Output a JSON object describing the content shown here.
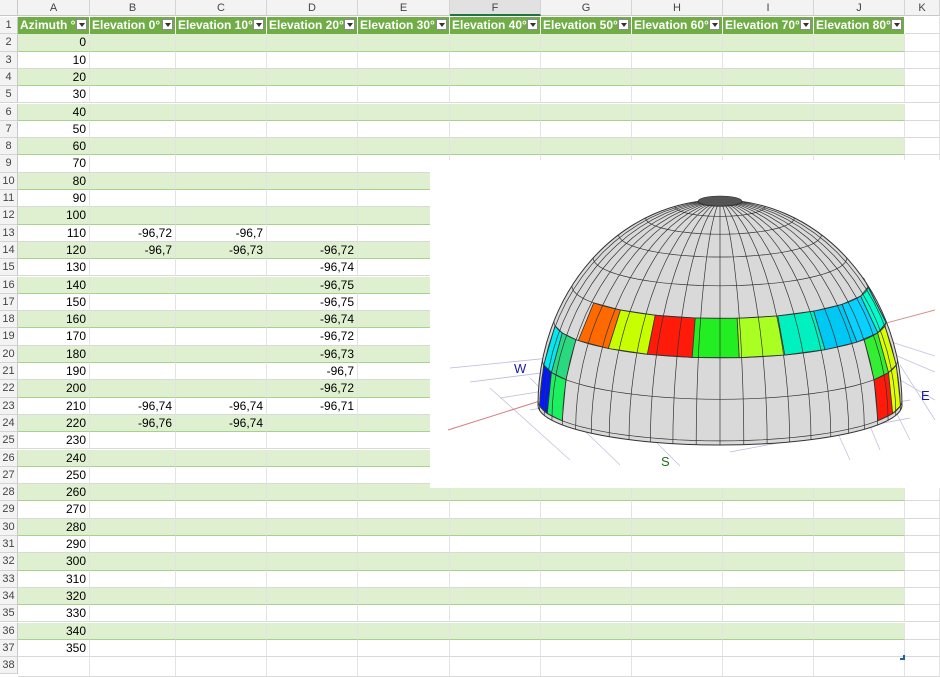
{
  "columns": [
    "A",
    "B",
    "C",
    "D",
    "E",
    "F",
    "G",
    "H",
    "I",
    "J",
    "K"
  ],
  "selected_column": "F",
  "header_row": [
    "Azimuth °",
    "Elevation 0°",
    "Elevation 10°",
    "Elevation 20°",
    "Elevation 30°",
    "Elevation 40°",
    "Elevation 50°",
    "Elevation 60°",
    "Elevation 70°",
    "Elevation 80°"
  ],
  "row_numbers": [
    1,
    2,
    3,
    4,
    5,
    6,
    7,
    8,
    9,
    10,
    11,
    12,
    13,
    14,
    15,
    16,
    17,
    18,
    19,
    20,
    21,
    22,
    23,
    24,
    25,
    26,
    27,
    28,
    29,
    30,
    31,
    32,
    33,
    34,
    35,
    36,
    37,
    38
  ],
  "rows": [
    {
      "az": "0"
    },
    {
      "az": "10"
    },
    {
      "az": "20"
    },
    {
      "az": "30"
    },
    {
      "az": "40"
    },
    {
      "az": "50"
    },
    {
      "az": "60"
    },
    {
      "az": "70"
    },
    {
      "az": "80"
    },
    {
      "az": "90"
    },
    {
      "az": "100"
    },
    {
      "az": "110",
      "b": "-96,72",
      "c": "-96,7"
    },
    {
      "az": "120",
      "b": "-96,7",
      "c": "-96,73",
      "d": "-96,72"
    },
    {
      "az": "130",
      "d": "-96,74"
    },
    {
      "az": "140",
      "d": "-96,75"
    },
    {
      "az": "150",
      "d": "-96,75"
    },
    {
      "az": "160",
      "d": "-96,74"
    },
    {
      "az": "170",
      "d": "-96,72"
    },
    {
      "az": "180",
      "d": "-96,73"
    },
    {
      "az": "190",
      "d": "-96,7"
    },
    {
      "az": "200",
      "d": "-96,72"
    },
    {
      "az": "210",
      "b": "-96,74",
      "c": "-96,74",
      "d": "-96,71"
    },
    {
      "az": "220",
      "b": "-96,76",
      "c": "-96,74"
    },
    {
      "az": "230"
    },
    {
      "az": "240"
    },
    {
      "az": "250"
    },
    {
      "az": "260"
    },
    {
      "az": "270"
    },
    {
      "az": "280"
    },
    {
      "az": "290"
    },
    {
      "az": "300"
    },
    {
      "az": "310"
    },
    {
      "az": "320"
    },
    {
      "az": "330"
    },
    {
      "az": "340"
    },
    {
      "az": "350"
    }
  ],
  "chart": {
    "directions": {
      "w": "W",
      "e": "E",
      "s": "S"
    },
    "colors": {
      "header_green": "#70ad47",
      "band_green": "#dff0d0",
      "dome_gray": "#d9d9d9",
      "direction_blue": "#1a1a9c",
      "direction_green": "#1e6e1e"
    },
    "colored_patches": [
      {
        "ring": "upper",
        "color": "#ff6a00"
      },
      {
        "ring": "upper",
        "color": "#c8ff00"
      },
      {
        "ring": "upper",
        "color": "#ff1a0a"
      },
      {
        "ring": "upper",
        "color": "#22ee22"
      },
      {
        "ring": "upper",
        "color": "#aaff22"
      },
      {
        "ring": "upper",
        "color": "#00f0c0"
      },
      {
        "ring": "upper",
        "color": "#00c8f5"
      },
      {
        "ring": "upper",
        "color": "#08d0ff"
      },
      {
        "ring": "upper",
        "color": "#00ffcc"
      },
      {
        "ring": "upper",
        "color": "#bfff00"
      },
      {
        "ring": "left",
        "color": "#00e8f0"
      },
      {
        "ring": "left",
        "color": "#2ad880"
      },
      {
        "ring": "left",
        "color": "#0018ff"
      },
      {
        "ring": "left",
        "color": "#1cf060"
      },
      {
        "ring": "right",
        "color": "#33ee33"
      },
      {
        "ring": "right",
        "color": "#d8ff00"
      },
      {
        "ring": "right",
        "color": "#ff1a0a"
      },
      {
        "ring": "right",
        "color": "#e0ff00"
      }
    ]
  }
}
